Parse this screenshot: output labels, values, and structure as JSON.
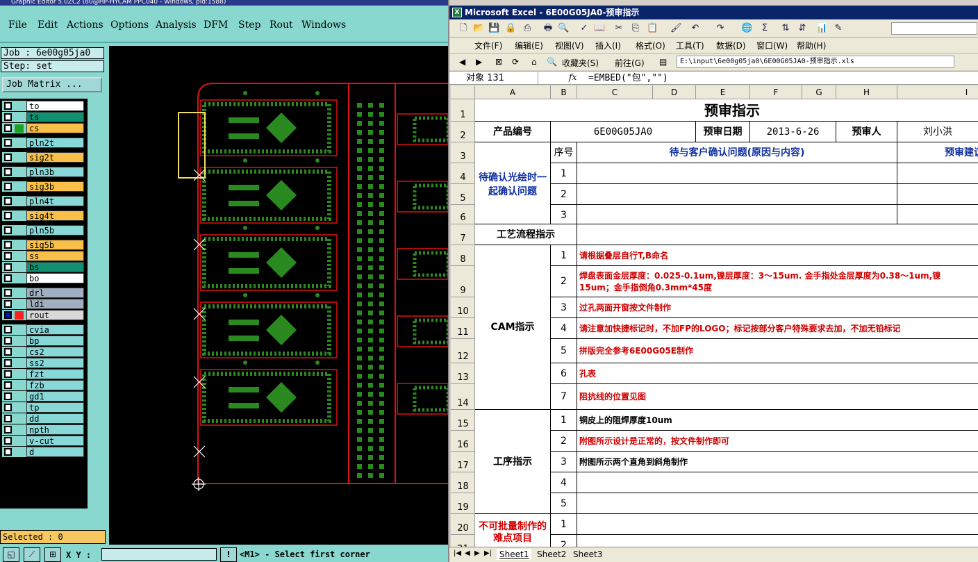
{
  "ge": {
    "title": "Graphic Editor 5.0ZC2 (80@HP-HYCAM PPC040 - Windows, pid:1588)",
    "menu": [
      "File",
      "Edit",
      "Actions",
      "Options",
      "Analysis",
      "DFM",
      "Step",
      "Rout",
      "Windows"
    ],
    "job": "Job : 6e00g05ja0",
    "step": "Step: set",
    "job_matrix": "Job Matrix ...",
    "layers": [
      {
        "name": "to",
        "color": "#ffffff",
        "swatch": ""
      },
      {
        "name": "ts",
        "color": "#109070",
        "swatch": ""
      },
      {
        "name": "cs",
        "color": "#f8c048",
        "swatch": "#20a020"
      },
      {
        "name": "pln2t",
        "color": "#88d8d8",
        "swatch": ""
      },
      {
        "name": "sig2t",
        "color": "#f8c048",
        "swatch": ""
      },
      {
        "name": "pln3b",
        "color": "#88d8d8",
        "swatch": ""
      },
      {
        "name": "sig3b",
        "color": "#f8c048",
        "swatch": ""
      },
      {
        "name": "pln4t",
        "color": "#88d8d8",
        "swatch": ""
      },
      {
        "name": "sig4t",
        "color": "#f8c048",
        "swatch": ""
      },
      {
        "name": "pln5b",
        "color": "#88d8d8",
        "swatch": ""
      },
      {
        "name": "sig5b",
        "color": "#f8c048",
        "swatch": ""
      },
      {
        "name": "ss",
        "color": "#f8c048",
        "swatch": ""
      },
      {
        "name": "bs",
        "color": "#109070",
        "swatch": ""
      },
      {
        "name": "bo",
        "color": "#ffffff",
        "swatch": ""
      },
      {
        "name": "drl",
        "color": "#a0b0c0",
        "swatch": ""
      },
      {
        "name": "ldi",
        "color": "#a0b0c0",
        "swatch": ""
      },
      {
        "name": "rout",
        "color": "#d8d8d8",
        "swatch": "#ff2020",
        "active": true
      },
      {
        "name": "cvia",
        "color": "#88d8d8",
        "swatch": ""
      },
      {
        "name": "bp",
        "color": "#88d8d8",
        "swatch": ""
      },
      {
        "name": "cs2",
        "color": "#88d8d8",
        "swatch": ""
      },
      {
        "name": "ss2",
        "color": "#88d8d8",
        "swatch": ""
      },
      {
        "name": "fzt",
        "color": "#88d8d8",
        "swatch": ""
      },
      {
        "name": "fzb",
        "color": "#88d8d8",
        "swatch": ""
      },
      {
        "name": "gd1",
        "color": "#88d8d8",
        "swatch": ""
      },
      {
        "name": "tp",
        "color": "#88d8d8",
        "swatch": ""
      },
      {
        "name": "dd",
        "color": "#88d8d8",
        "swatch": ""
      },
      {
        "name": "npth",
        "color": "#88d8d8",
        "swatch": ""
      },
      {
        "name": "v-cut",
        "color": "#88d8d8",
        "swatch": ""
      },
      {
        "name": "d",
        "color": "#88d8d8",
        "swatch": ""
      }
    ],
    "selected": "Selected : 0",
    "xy_label": "X Y :",
    "prompt": "<M1> - Select first corner"
  },
  "xl": {
    "title": "Microsoft Excel - 6E00G05JA0-预审指示",
    "menu": [
      "文件(F)",
      "编辑(E)",
      "视图(V)",
      "插入(I)",
      "格式(O)",
      "工具(T)",
      "数据(D)",
      "窗口(W)",
      "帮助(H)"
    ],
    "favorites": "收藏夹(S)",
    "goto": "前往(G)",
    "address": "E:\\input\\6e00g05ja0\\6E00G05JA0-预审指示.xls",
    "namebox": "对象 131",
    "formula": "=EMBED(\"包\",\"\")",
    "cols": [
      "A",
      "B",
      "C",
      "D",
      "E",
      "F",
      "G",
      "H",
      "I"
    ],
    "sheet_title": "预审指示",
    "product_label": "产品编号",
    "product_no": "6E00G05JA0",
    "date_label": "预审日期",
    "date": "2013-6-26",
    "reviewer_label": "预审人",
    "reviewer": "刘小洪",
    "seq_label": "序号",
    "pending_header": "待与客户确认问题(原因与内容)",
    "suggest_header": "预审建议",
    "pending_label": "待确认光绘时一起确认问题",
    "process_label": "工艺流程指示",
    "cam_label": "CAM指示",
    "cam_items": [
      "请根据叠层自行T,B命名",
      "焊盘表面金层厚度：0.025-0.1um,镍层厚度：3～15um. 金手指处金层厚度为0.38～1um,镍",
      "过孔两面开窗按文件制作",
      "请注意加快捷标记时，不加FP的LOGO；标记按部分客户特殊要求去加，不加无铅标记",
      "拼版完全参考6E00G05E制作",
      "孔表",
      "阻抗线的位置见图"
    ],
    "cam_item2_line2": "15um；金手指倒角0.3mm*45度",
    "op_label": "工序指示",
    "op_items": [
      "铜皮上的阻焊厚度10um",
      "附图所示设计是正常的，按文件制作即可",
      "附图所示两个直角到斜角制作",
      "",
      ""
    ],
    "hard_label": "不可批量制作的难点项目",
    "sheets": [
      "Sheet1",
      "Sheet2",
      "Sheet3"
    ]
  }
}
